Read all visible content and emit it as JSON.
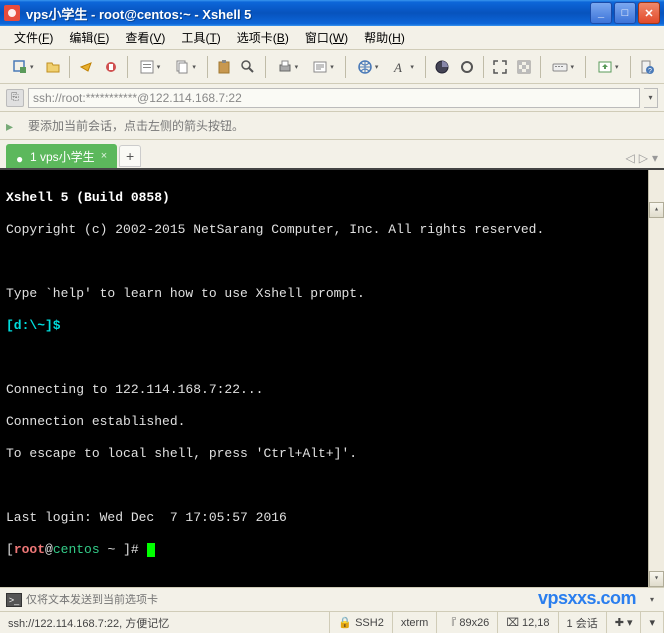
{
  "window": {
    "title": "vps小学生 - root@centos:~ - Xshell 5"
  },
  "menu": {
    "file": "文件",
    "file_k": "F",
    "edit": "编辑",
    "edit_k": "E",
    "view": "查看",
    "view_k": "V",
    "tools": "工具",
    "tools_k": "T",
    "tabs": "选项卡",
    "tabs_k": "B",
    "window": "窗口",
    "window_k": "W",
    "help": "帮助",
    "help_k": "H"
  },
  "address": {
    "url": "ssh://root:***********@122.114.168.7:22"
  },
  "hint": {
    "text": "要添加当前会话，点击左侧的箭头按钮。"
  },
  "tab": {
    "label": "1 vps小学生",
    "close": "×",
    "new": "+",
    "nav_left": "◁",
    "nav_right": "▷",
    "nav_dd": "▾"
  },
  "terminal": {
    "l1": "Xshell 5 (Build 0858)",
    "l2": "Copyright (c) 2002-2015 NetSarang Computer, Inc. All rights reserved.",
    "l3": "",
    "l4": "Type `help' to learn how to use Xshell prompt.",
    "l5": "[d:\\~]$ ",
    "l6": "",
    "l7": "Connecting to 122.114.168.7:22...",
    "l8": "Connection established.",
    "l9": "To escape to local shell, press 'Ctrl+Alt+]'.",
    "l10": "",
    "l11": "Last login: Wed Dec  7 17:05:57 2016",
    "l12_user": "root",
    "l12_host": "centos",
    "l12_path": "~",
    "l12_at": "@",
    "l12_lb": "[",
    "l12_rb": " ]# "
  },
  "input": {
    "placeholder": "仅将文本发送到当前选项卡"
  },
  "status": {
    "main": "ssh://122.114.168.7:22, 方便记忆",
    "ssh": "SSH2",
    "term": "xterm",
    "size_i": "『",
    "size": "89x26",
    "pos_i": "⌧",
    "pos": "12,18",
    "sess": "1 会话",
    "cap_i": "✚",
    "cap_dd": "▾",
    "cap2_dd": "▾"
  },
  "icons": {
    "min": "_",
    "max": "□",
    "close": "✕",
    "dd": "▾",
    "hint": "▸",
    "sb_up": "▴",
    "sb_dn": "▾",
    "cmd": ">_",
    "lock": "🔒"
  },
  "watermark": "vpsxxs.com"
}
